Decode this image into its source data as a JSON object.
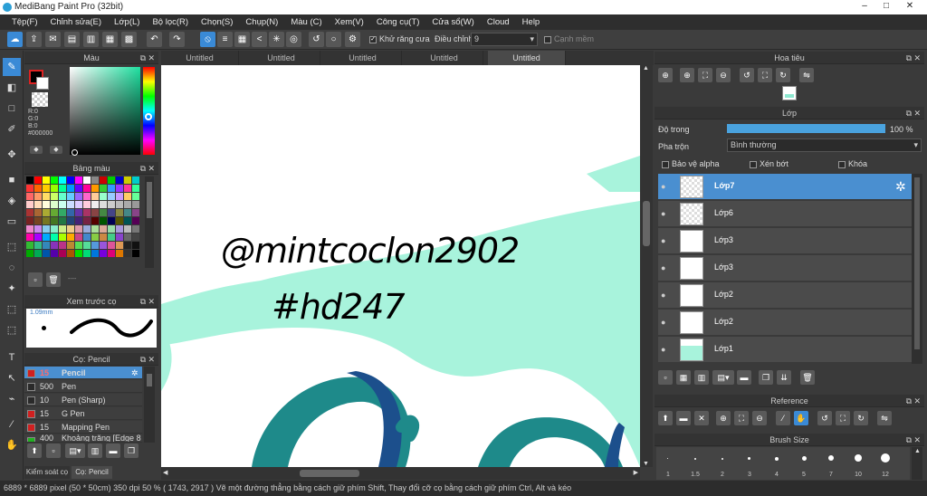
{
  "window": {
    "title": "MediBang Paint Pro (32bit)"
  },
  "menu": [
    "Tệp(F)",
    "Chỉnh sửa(E)",
    "Lớp(L)",
    "Bộ lọc(R)",
    "Chọn(S)",
    "Chụp(N)",
    "Màu (C)",
    "Xem(V)",
    "Công cụ(T)",
    "Cửa sổ(W)",
    "Cloud",
    "Help"
  ],
  "toolbar": {
    "antialias_label": "Khử răng cưa",
    "correction_label": "Điều chỉnh",
    "correction_value": "9",
    "edge_label": "Cạnh mềm"
  },
  "color_panel": {
    "title": "Màu",
    "r": "R:0",
    "g": "G:0",
    "b": "B:0",
    "hex": "#000000"
  },
  "palette_panel": {
    "title": "Bảng màu",
    "extra": "----"
  },
  "brush_preview": {
    "title": "Xem trước cọ",
    "size": "1.09mm"
  },
  "brush_panel": {
    "title": "Cọ: Pencil",
    "brushes": [
      {
        "size": "15",
        "name": "Pencil",
        "color": "#d02020",
        "selected": true
      },
      {
        "size": "500",
        "name": "Pen",
        "color": "#2a2a2a"
      },
      {
        "size": "10",
        "name": "Pen (Sharp)",
        "color": "#2a2a2a"
      },
      {
        "size": "15",
        "name": "G Pen",
        "color": "#d02020"
      },
      {
        "size": "15",
        "name": "Mapping Pen",
        "color": "#d02020"
      },
      {
        "size": "400",
        "name": "Khoảng trắng [Edge 8",
        "color": "#20b020"
      }
    ],
    "bottom_tabs": [
      "Kiểm soát cọ",
      "Cọ: Pencil"
    ]
  },
  "doc_tabs": [
    "Untitled",
    "Untitled",
    "Untitled",
    "Untitled",
    "Untitled"
  ],
  "canvas": {
    "line1": "@mintcoclon2902",
    "line2": "#hd247"
  },
  "navigator": {
    "title": "Hoa tiêu"
  },
  "layers_panel": {
    "title": "Lớp",
    "opacity_label": "Độ trong",
    "opacity_value": "100 %",
    "blend_label": "Pha trộn",
    "blend_value": "Bình thường",
    "protect_alpha": "Bảo vệ alpha",
    "clipping": "Xén bớt",
    "lock": "Khóa",
    "layers": [
      "Lớp7",
      "Lớp6",
      "Lớp3",
      "Lớp3",
      "Lớp2",
      "Lớp2",
      "Lớp1"
    ]
  },
  "reference_panel": {
    "title": "Reference"
  },
  "brush_size_panel": {
    "title": "Brush Size",
    "sizes": [
      "1",
      "1.5",
      "2",
      "3",
      "4",
      "5",
      "7",
      "10",
      "12"
    ]
  },
  "status": "6889 * 6889 pixel  (50 * 50cm)  350 dpi  50 %  ( 1743, 2917 )  Vẽ một đường thẳng bằng cách giữ phím Shift, Thay đổi cỡ cọ bằng cách giữ phím Ctrl, Alt và kéo"
}
